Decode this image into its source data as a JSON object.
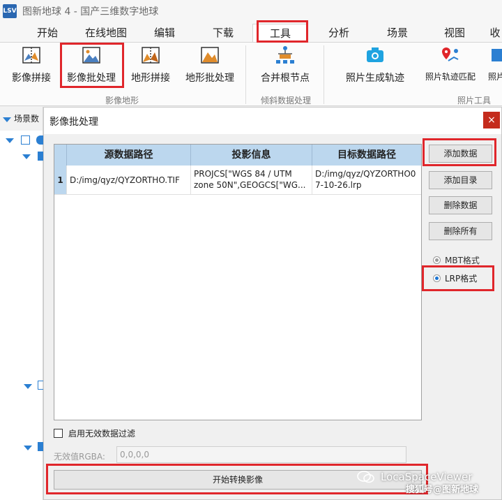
{
  "window": {
    "logo": "LSV",
    "title": "图新地球 4 - 国产三维数字地球"
  },
  "menu": {
    "tabs": [
      {
        "label": "开始"
      },
      {
        "label": "在线地图"
      },
      {
        "label": "编辑"
      },
      {
        "label": "下载"
      },
      {
        "label": "工具",
        "active": true
      },
      {
        "label": "分析"
      },
      {
        "label": "场景"
      },
      {
        "label": "视图"
      },
      {
        "label": "收"
      }
    ]
  },
  "ribbon": {
    "groups": [
      {
        "label": "影像地形",
        "buttons": [
          {
            "label": "影像拼接",
            "icon": "image-mosaic-icon"
          },
          {
            "label": "影像批处理",
            "icon": "image-batch-icon"
          },
          {
            "label": "地形拼接",
            "icon": "terrain-mosaic-icon"
          },
          {
            "label": "地形批处理",
            "icon": "terrain-batch-icon"
          }
        ]
      },
      {
        "label": "倾斜数据处理",
        "buttons": [
          {
            "label": "合并根节点",
            "icon": "merge-root-node-icon"
          }
        ]
      },
      {
        "label": "照片工具",
        "buttons": [
          {
            "label": "照片生成轨迹",
            "icon": "camera-icon"
          },
          {
            "label": "照片轨迹匹配",
            "icon": "map-pin-track-icon"
          },
          {
            "label": "照片",
            "icon": "photo-icon"
          }
        ]
      }
    ]
  },
  "left_panel": {
    "header": "场景数"
  },
  "dialog": {
    "title": "影像批处理",
    "close_glyph": "×",
    "grid": {
      "columns": [
        "",
        "源数据路径",
        "投影信息",
        "目标数据路径"
      ],
      "rows": [
        {
          "index": "1",
          "source": "D:/img/qyz/QYZORTHO.TIF",
          "projection": "PROJCS[\"WGS 84 / UTM zone 50N\",GEOGCS[\"WG...",
          "target": "D:/img/qyz/QYZORTHO07-10-26.lrp"
        }
      ]
    },
    "buttons": {
      "add_data": "添加数据",
      "add_dir": "添加目录",
      "delete_data": "删除数据",
      "delete_all": "删除所有"
    },
    "format": {
      "mbt_label": "MBT格式",
      "lrp_label": "LRP格式",
      "selected": "LRP格式"
    },
    "filter": {
      "checkbox_label": "启用无效数据过滤",
      "checked": false,
      "rgba_label": "无效值RGBA:",
      "rgba_value": "0,0,0,0"
    },
    "start_button": "开始转换影像"
  },
  "watermark": {
    "text": "LocaSpaceViewer",
    "source": "搜狐号@图新地球"
  },
  "colors": {
    "highlight": "#e0262b",
    "header_blue": "#bcd7ee",
    "accent": "#2b7fd2",
    "close_red": "#c42b1c"
  }
}
